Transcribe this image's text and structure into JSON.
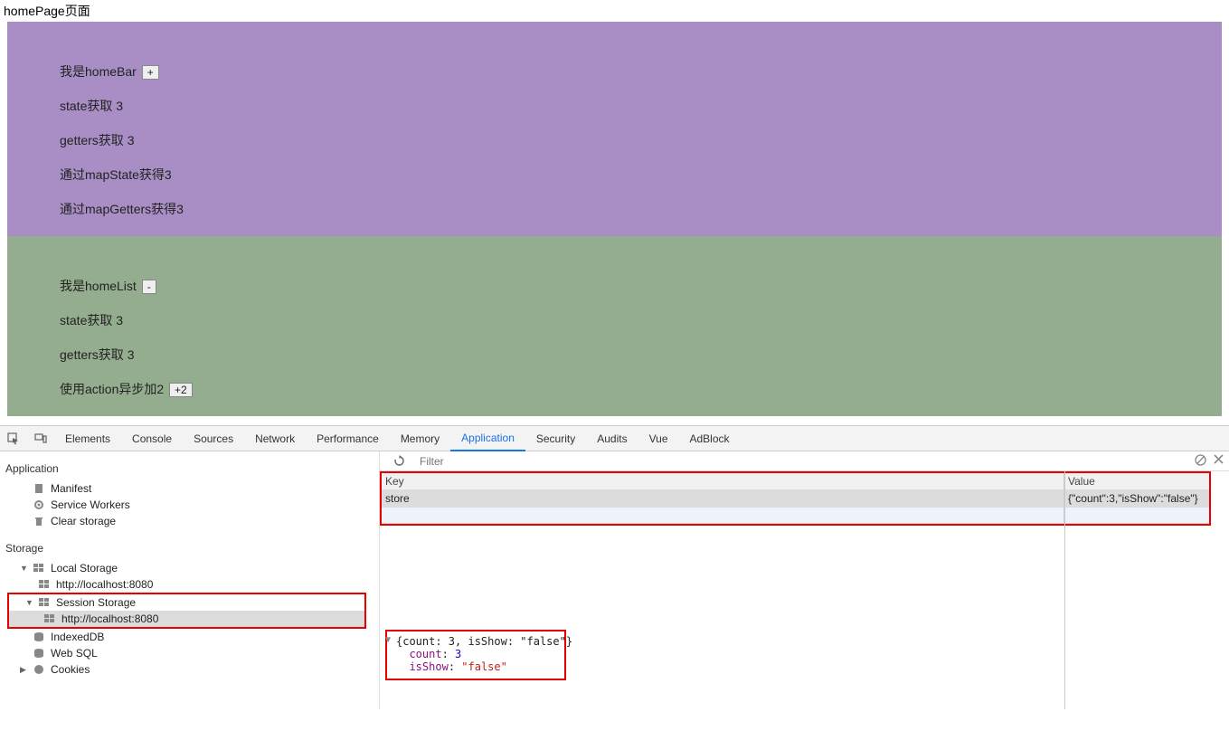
{
  "page": {
    "title": "homePage页面"
  },
  "homeBar": {
    "title": "我是homeBar",
    "plus": "+",
    "state": "state获取 3",
    "getters": "getters获取 3",
    "mapState": "通过mapState获得3",
    "mapGetters": "通过mapGetters获得3"
  },
  "homeList": {
    "title": "我是homeList",
    "minus": "-",
    "state": "state获取 3",
    "getters": "getters获取 3",
    "action": "使用action异步加2",
    "actionBtn": "+2"
  },
  "devtools": {
    "tabs": [
      "Elements",
      "Console",
      "Sources",
      "Network",
      "Performance",
      "Memory",
      "Application",
      "Security",
      "Audits",
      "Vue",
      "AdBlock"
    ],
    "activeTab": "Application"
  },
  "appSidebar": {
    "appHeader": "Application",
    "manifest": "Manifest",
    "serviceWorkers": "Service Workers",
    "clearStorage": "Clear storage",
    "storageHeader": "Storage",
    "localStorage": "Local Storage",
    "localHost": "http://localhost:8080",
    "sessionStorage": "Session Storage",
    "sessionHost": "http://localhost:8080",
    "indexedDB": "IndexedDB",
    "webSQL": "Web SQL",
    "cookies": "Cookies"
  },
  "filter": {
    "placeholder": "Filter"
  },
  "kvTable": {
    "keyHeader": "Key",
    "valHeader": "Value",
    "rowKey": "store",
    "rowVal": "{\"count\":3,\"isShow\":\"false\"}"
  },
  "jsonView": {
    "line1": "{count: 3, isShow: \"false\"}",
    "line2k": "count",
    "line2v": "3",
    "line3k": "isShow",
    "line3v": "\"false\""
  }
}
